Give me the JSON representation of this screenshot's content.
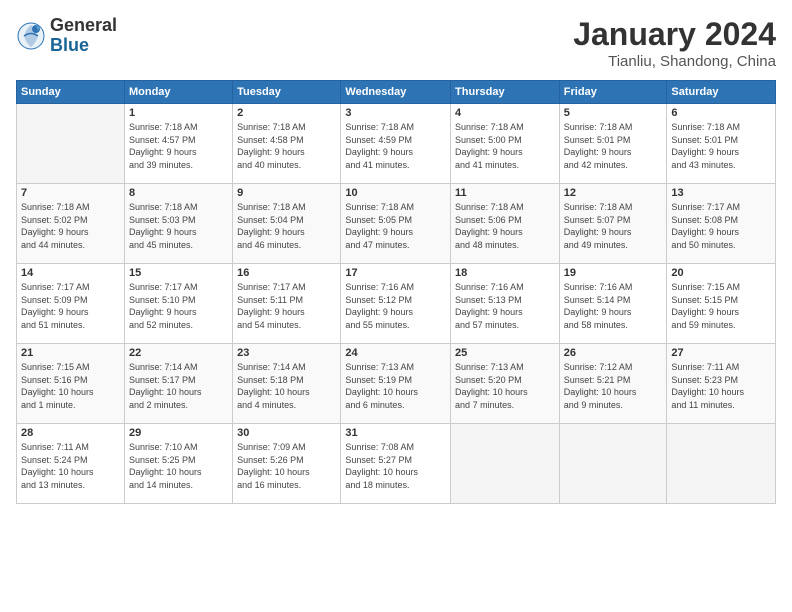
{
  "header": {
    "logo_general": "General",
    "logo_blue": "Blue",
    "month_title": "January 2024",
    "location": "Tianliu, Shandong, China"
  },
  "calendar": {
    "days_of_week": [
      "Sunday",
      "Monday",
      "Tuesday",
      "Wednesday",
      "Thursday",
      "Friday",
      "Saturday"
    ],
    "weeks": [
      [
        {
          "day": "",
          "info": ""
        },
        {
          "day": "1",
          "info": "Sunrise: 7:18 AM\nSunset: 4:57 PM\nDaylight: 9 hours\nand 39 minutes."
        },
        {
          "day": "2",
          "info": "Sunrise: 7:18 AM\nSunset: 4:58 PM\nDaylight: 9 hours\nand 40 minutes."
        },
        {
          "day": "3",
          "info": "Sunrise: 7:18 AM\nSunset: 4:59 PM\nDaylight: 9 hours\nand 41 minutes."
        },
        {
          "day": "4",
          "info": "Sunrise: 7:18 AM\nSunset: 5:00 PM\nDaylight: 9 hours\nand 41 minutes."
        },
        {
          "day": "5",
          "info": "Sunrise: 7:18 AM\nSunset: 5:01 PM\nDaylight: 9 hours\nand 42 minutes."
        },
        {
          "day": "6",
          "info": "Sunrise: 7:18 AM\nSunset: 5:01 PM\nDaylight: 9 hours\nand 43 minutes."
        }
      ],
      [
        {
          "day": "7",
          "info": "Sunrise: 7:18 AM\nSunset: 5:02 PM\nDaylight: 9 hours\nand 44 minutes."
        },
        {
          "day": "8",
          "info": "Sunrise: 7:18 AM\nSunset: 5:03 PM\nDaylight: 9 hours\nand 45 minutes."
        },
        {
          "day": "9",
          "info": "Sunrise: 7:18 AM\nSunset: 5:04 PM\nDaylight: 9 hours\nand 46 minutes."
        },
        {
          "day": "10",
          "info": "Sunrise: 7:18 AM\nSunset: 5:05 PM\nDaylight: 9 hours\nand 47 minutes."
        },
        {
          "day": "11",
          "info": "Sunrise: 7:18 AM\nSunset: 5:06 PM\nDaylight: 9 hours\nand 48 minutes."
        },
        {
          "day": "12",
          "info": "Sunrise: 7:18 AM\nSunset: 5:07 PM\nDaylight: 9 hours\nand 49 minutes."
        },
        {
          "day": "13",
          "info": "Sunrise: 7:17 AM\nSunset: 5:08 PM\nDaylight: 9 hours\nand 50 minutes."
        }
      ],
      [
        {
          "day": "14",
          "info": "Sunrise: 7:17 AM\nSunset: 5:09 PM\nDaylight: 9 hours\nand 51 minutes."
        },
        {
          "day": "15",
          "info": "Sunrise: 7:17 AM\nSunset: 5:10 PM\nDaylight: 9 hours\nand 52 minutes."
        },
        {
          "day": "16",
          "info": "Sunrise: 7:17 AM\nSunset: 5:11 PM\nDaylight: 9 hours\nand 54 minutes."
        },
        {
          "day": "17",
          "info": "Sunrise: 7:16 AM\nSunset: 5:12 PM\nDaylight: 9 hours\nand 55 minutes."
        },
        {
          "day": "18",
          "info": "Sunrise: 7:16 AM\nSunset: 5:13 PM\nDaylight: 9 hours\nand 57 minutes."
        },
        {
          "day": "19",
          "info": "Sunrise: 7:16 AM\nSunset: 5:14 PM\nDaylight: 9 hours\nand 58 minutes."
        },
        {
          "day": "20",
          "info": "Sunrise: 7:15 AM\nSunset: 5:15 PM\nDaylight: 9 hours\nand 59 minutes."
        }
      ],
      [
        {
          "day": "21",
          "info": "Sunrise: 7:15 AM\nSunset: 5:16 PM\nDaylight: 10 hours\nand 1 minute."
        },
        {
          "day": "22",
          "info": "Sunrise: 7:14 AM\nSunset: 5:17 PM\nDaylight: 10 hours\nand 2 minutes."
        },
        {
          "day": "23",
          "info": "Sunrise: 7:14 AM\nSunset: 5:18 PM\nDaylight: 10 hours\nand 4 minutes."
        },
        {
          "day": "24",
          "info": "Sunrise: 7:13 AM\nSunset: 5:19 PM\nDaylight: 10 hours\nand 6 minutes."
        },
        {
          "day": "25",
          "info": "Sunrise: 7:13 AM\nSunset: 5:20 PM\nDaylight: 10 hours\nand 7 minutes."
        },
        {
          "day": "26",
          "info": "Sunrise: 7:12 AM\nSunset: 5:21 PM\nDaylight: 10 hours\nand 9 minutes."
        },
        {
          "day": "27",
          "info": "Sunrise: 7:11 AM\nSunset: 5:23 PM\nDaylight: 10 hours\nand 11 minutes."
        }
      ],
      [
        {
          "day": "28",
          "info": "Sunrise: 7:11 AM\nSunset: 5:24 PM\nDaylight: 10 hours\nand 13 minutes."
        },
        {
          "day": "29",
          "info": "Sunrise: 7:10 AM\nSunset: 5:25 PM\nDaylight: 10 hours\nand 14 minutes."
        },
        {
          "day": "30",
          "info": "Sunrise: 7:09 AM\nSunset: 5:26 PM\nDaylight: 10 hours\nand 16 minutes."
        },
        {
          "day": "31",
          "info": "Sunrise: 7:08 AM\nSunset: 5:27 PM\nDaylight: 10 hours\nand 18 minutes."
        },
        {
          "day": "",
          "info": ""
        },
        {
          "day": "",
          "info": ""
        },
        {
          "day": "",
          "info": ""
        }
      ]
    ]
  }
}
